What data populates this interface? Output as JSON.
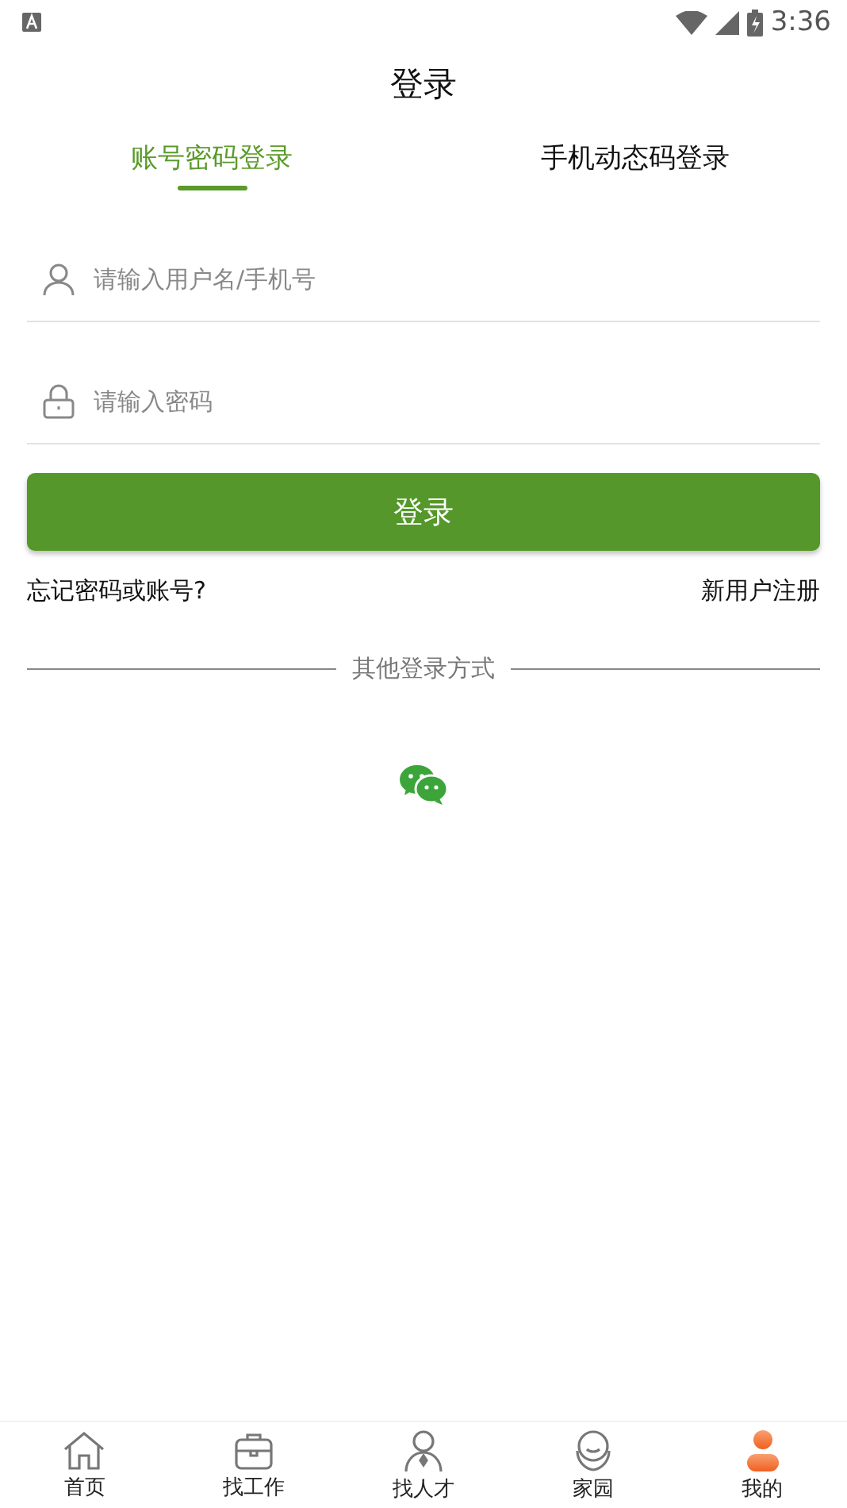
{
  "status_bar": {
    "time": "3:36"
  },
  "header": {
    "title": "登录"
  },
  "tabs": [
    {
      "label": "账号密码登录",
      "selected": true
    },
    {
      "label": "手机动态码登录",
      "selected": false
    }
  ],
  "fields": [
    {
      "placeholder": "请输入用户名/手机号",
      "kind": "user"
    },
    {
      "placeholder": "请输入密码",
      "kind": "password"
    }
  ],
  "login_button": "登录",
  "links": {
    "forgot": "忘记密码或账号?",
    "register": "新用户注册"
  },
  "other_login": {
    "label": "其他登录方式"
  },
  "bottom_nav": [
    {
      "label": "首页",
      "selected": false
    },
    {
      "label": "找工作",
      "selected": false
    },
    {
      "label": "找人才",
      "selected": false
    },
    {
      "label": "家园",
      "selected": false
    },
    {
      "label": "我的",
      "selected": true
    }
  ]
}
